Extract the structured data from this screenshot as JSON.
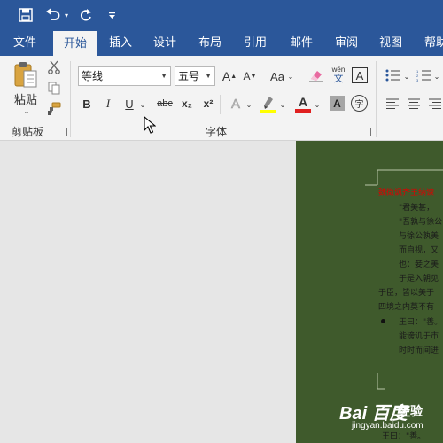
{
  "quick_access": {
    "save_icon": "save-icon",
    "undo_icon": "undo-icon",
    "redo_icon": "redo-icon",
    "customize_icon": "customize-qat-icon"
  },
  "tabs": [
    {
      "label": "文件"
    },
    {
      "label": "开始",
      "active": true
    },
    {
      "label": "插入"
    },
    {
      "label": "设计"
    },
    {
      "label": "布局"
    },
    {
      "label": "引用"
    },
    {
      "label": "邮件"
    },
    {
      "label": "审阅"
    },
    {
      "label": "视图"
    },
    {
      "label": "帮助"
    }
  ],
  "clipboard": {
    "paste_label": "粘贴",
    "group_label": "剪贴板"
  },
  "font": {
    "group_label": "字体",
    "font_name": "等线",
    "font_size": "五号",
    "bold": "B",
    "italic": "I",
    "underline": "U",
    "strikethrough": "abc",
    "subscript": "x₂",
    "superscript": "x²",
    "change_case": "Aa",
    "phonetic_top": "wén",
    "phonetic_bottom": "文",
    "char_border": "A",
    "grow": "A",
    "shrink": "A",
    "text_effect": "A",
    "font_color": "A",
    "char_shading": "A",
    "enclose": "字"
  },
  "colors": {
    "title_bar": "#2b579a",
    "ribbon": "#f3f3f3",
    "page_bg": "#3f5a2c",
    "font_color_bar": "#e02020",
    "highlight_bar": "#ffff00"
  },
  "document": {
    "lines": [
      {
        "text": "魏徵讽齐王纳谏",
        "style": "red"
      },
      {
        "text": "\"君美甚，"
      },
      {
        "text": "\"吾孰与徐公"
      },
      {
        "text": "与徐公孰美"
      },
      {
        "text": "而自视，又"
      },
      {
        "text": "也：妾之美"
      },
      {
        "text": "于是入朝见"
      },
      {
        "text": "于臣，皆以美于"
      },
      {
        "text": "四境之内莫不有"
      },
      {
        "text": "王曰：\"善。"
      },
      {
        "text": "能谤讥于市"
      },
      {
        "text": "时时而间进"
      },
      {
        "text": "王曰：\"善。"
      }
    ]
  },
  "watermark": {
    "brand": "Bai 百度",
    "jingyan": "经验",
    "url": "jingyan.baidu.com"
  }
}
